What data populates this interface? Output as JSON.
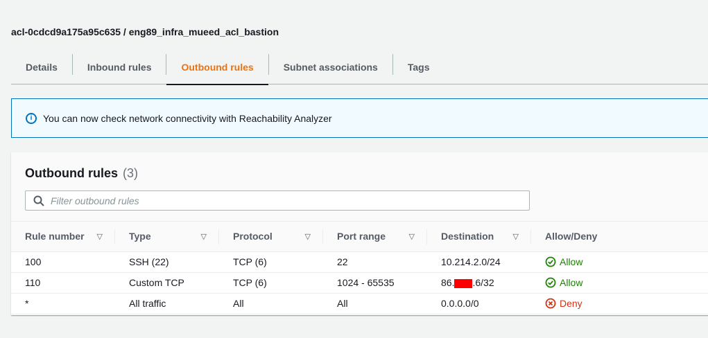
{
  "page": {
    "title": "acl-0cdcd9a175a95c635 / eng89_infra_mueed_acl_bastion"
  },
  "tabs": [
    {
      "label": "Details",
      "active": false
    },
    {
      "label": "Inbound rules",
      "active": false
    },
    {
      "label": "Outbound rules",
      "active": true
    },
    {
      "label": "Subnet associations",
      "active": false
    },
    {
      "label": "Tags",
      "active": false
    }
  ],
  "alert": {
    "icon": "info-icon",
    "text": "You can now check network connectivity with Reachability Analyzer"
  },
  "outbound": {
    "title": "Outbound rules",
    "count": "(3)",
    "filter_placeholder": "Filter outbound rules",
    "columns": [
      "Rule number",
      "Type",
      "Protocol",
      "Port range",
      "Destination",
      "Allow/Deny"
    ],
    "rows": [
      {
        "rule_number": "100",
        "type": "SSH (22)",
        "protocol": "TCP (6)",
        "port_range": "22",
        "destination": "10.214.2.0/24",
        "action": "Allow"
      },
      {
        "rule_number": "110",
        "type": "Custom TCP",
        "protocol": "TCP (6)",
        "port_range": "1024 - 65535",
        "destination_prefix": "86.",
        "destination_suffix": ".6/32",
        "action": "Allow"
      },
      {
        "rule_number": "*",
        "type": "All traffic",
        "protocol": "All",
        "port_range": "All",
        "destination": "0.0.0.0/0",
        "action": "Deny"
      }
    ]
  },
  "colors": {
    "accent": "#ec7211",
    "allow": "#1d8102",
    "deny": "#d13212",
    "info": "#0073bb"
  }
}
